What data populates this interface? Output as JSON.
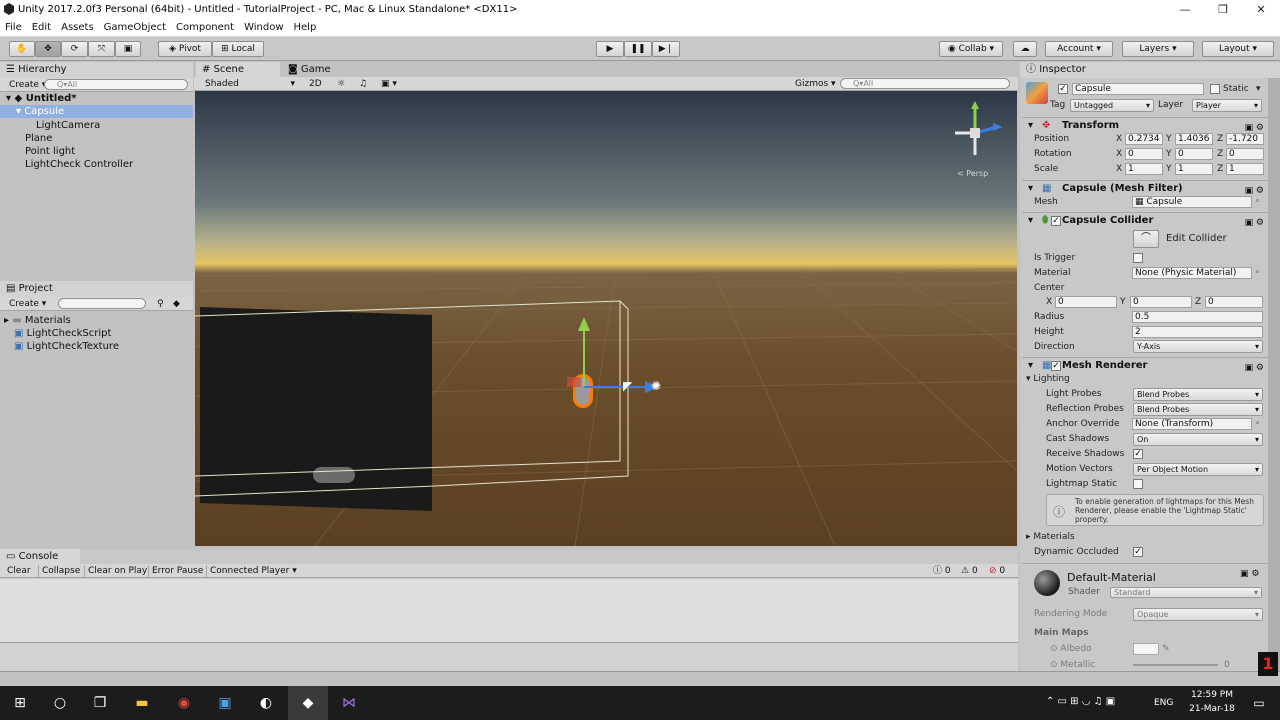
{
  "window": {
    "title": "Unity 2017.2.0f3 Personal (64bit) - Untitled - TutorialProject - PC, Mac & Linux Standalone* <DX11>"
  },
  "menu": [
    "File",
    "Edit",
    "Assets",
    "GameObject",
    "Component",
    "Window",
    "Help"
  ],
  "toolbar": {
    "pivot": "Pivot",
    "local": "Local",
    "collab": "Collab",
    "account": "Account",
    "layers": "Layers",
    "layout": "Layout"
  },
  "hierarchy": {
    "tab": "Hierarchy",
    "create": "Create",
    "search": "Q▾All",
    "scene": "Untitled*",
    "items": [
      "Capsule",
      "LightCamera",
      "Plane",
      "Point light",
      "LightCheck Controller"
    ]
  },
  "project": {
    "tab": "Project",
    "create": "Create",
    "items": [
      "Materials",
      "LightCheckScript",
      "LightCheckTexture"
    ]
  },
  "scene": {
    "tab_scene": "Scene",
    "tab_game": "Game",
    "shaded": "Shaded",
    "mode_2d": "2D",
    "gizmos": "Gizmos",
    "search": "Q▾All",
    "persp": "< Persp"
  },
  "console": {
    "tab": "Console",
    "clear": "Clear",
    "collapse": "Collapse",
    "clear_on_play": "Clear on Play",
    "error_pause": "Error Pause",
    "connected": "Connected Player",
    "count_info": "0",
    "count_warn": "0",
    "count_err": "0"
  },
  "inspector": {
    "tab": "Inspector",
    "name": "Capsule",
    "static": "Static",
    "tag_label": "Tag",
    "tag": "Untagged",
    "layer_label": "Layer",
    "layer": "Player",
    "transform": {
      "title": "Transform",
      "position_label": "Position",
      "rotation_label": "Rotation",
      "scale_label": "Scale",
      "position": {
        "x": "0.2734",
        "y": "1.4036",
        "z": "-1.720"
      },
      "rotation": {
        "x": "0",
        "y": "0",
        "z": "0"
      },
      "scale": {
        "x": "1",
        "y": "1",
        "z": "1"
      }
    },
    "mesh_filter": {
      "title": "Capsule (Mesh Filter)",
      "mesh_label": "Mesh",
      "mesh": "Capsule"
    },
    "capsule_collider": {
      "title": "Capsule Collider",
      "edit": "Edit Collider",
      "is_trigger": "Is Trigger",
      "material_label": "Material",
      "material": "None (Physic Material)",
      "center_label": "Center",
      "center": {
        "x": "0",
        "y": "0",
        "z": "0"
      },
      "radius_label": "Radius",
      "radius": "0.5",
      "height_label": "Height",
      "height": "2",
      "direction_label": "Direction",
      "direction": "Y-Axis"
    },
    "mesh_renderer": {
      "title": "Mesh Renderer",
      "lighting": "Lighting",
      "light_probes_label": "Light Probes",
      "light_probes": "Blend Probes",
      "reflection_probes_label": "Reflection Probes",
      "reflection_probes": "Blend Probes",
      "anchor_label": "Anchor Override",
      "anchor": "None (Transform)",
      "cast_label": "Cast Shadows",
      "cast": "On",
      "receive_label": "Receive Shadows",
      "motion_label": "Motion Vectors",
      "motion": "Per Object Motion",
      "lightmap_label": "Lightmap Static",
      "info": "To enable generation of lightmaps for this Mesh Renderer, please enable the 'Lightmap Static' property.",
      "materials": "Materials",
      "dynamic": "Dynamic Occluded"
    },
    "material": {
      "name": "Default-Material",
      "shader_label": "Shader",
      "shader": "Standard",
      "rendering_label": "Rendering Mode",
      "rendering": "Opaque",
      "main_maps": "Main Maps",
      "albedo": "Albedo",
      "metallic": "Metallic",
      "metallic_value": "0"
    }
  },
  "taskbar": {
    "time": "12:59 PM",
    "date": "21-Mar-18",
    "lang": "ENG"
  },
  "colors": {
    "accent": "#3d7ee0",
    "selection": "#8fb0e0",
    "capsule": "#ff7a00"
  }
}
